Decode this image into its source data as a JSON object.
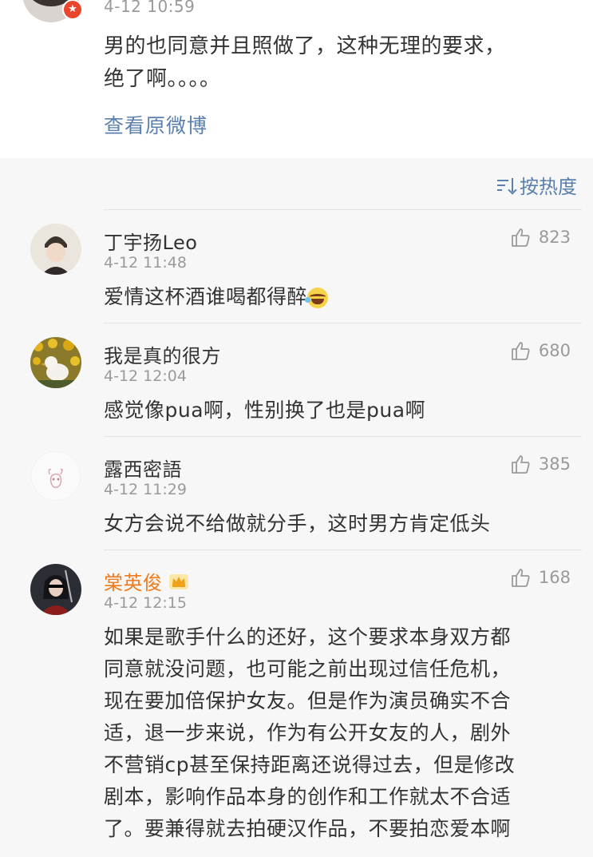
{
  "post": {
    "time": "4-12 10:59",
    "text_line1": "男的也同意并且照做了，这种无理的要求，",
    "text_line2": "绝了啊。。。。",
    "view_original": "查看原微博"
  },
  "sort": {
    "label": "按热度",
    "icon": "sort-icon"
  },
  "comments": [
    {
      "name": "丁宇扬Leo",
      "time": "4-12 11:48",
      "text": "爱情这杯酒谁喝都得醉",
      "likes": "823",
      "emoji": "laugh-cry-emoji"
    },
    {
      "name": "我是真的很方",
      "time": "4-12 12:04",
      "text": "感觉像pua啊，性别换了也是pua啊",
      "likes": "680"
    },
    {
      "name": "露西密語",
      "time": "4-12 11:29",
      "text": "女方会说不给做就分手，这时男方肯定低头",
      "likes": "385"
    },
    {
      "name": "棠英俊",
      "time": "4-12 12:15",
      "likes": "168",
      "badge": "crown-icon",
      "lines": [
        "如果是歌手什么的还好，这个要求本身双方都",
        "同意就没问题，也可能之前出现过信任危机，",
        "现在要加倍保护女友。但是作为演员确实不合",
        "适，退一步来说，作为有公开女友的人，剧外",
        "不营销cp甚至保持距离还说得过去，但是修改",
        "剧本，影响作品本身的创作和工作就太不合适",
        "了。要兼得就去拍硬汉作品，不要拍恋爱本啊"
      ]
    }
  ],
  "colors": {
    "link": "#5b80ad",
    "vip_name": "#f07b1d",
    "text": "#333333",
    "meta": "#9a9a9a"
  }
}
